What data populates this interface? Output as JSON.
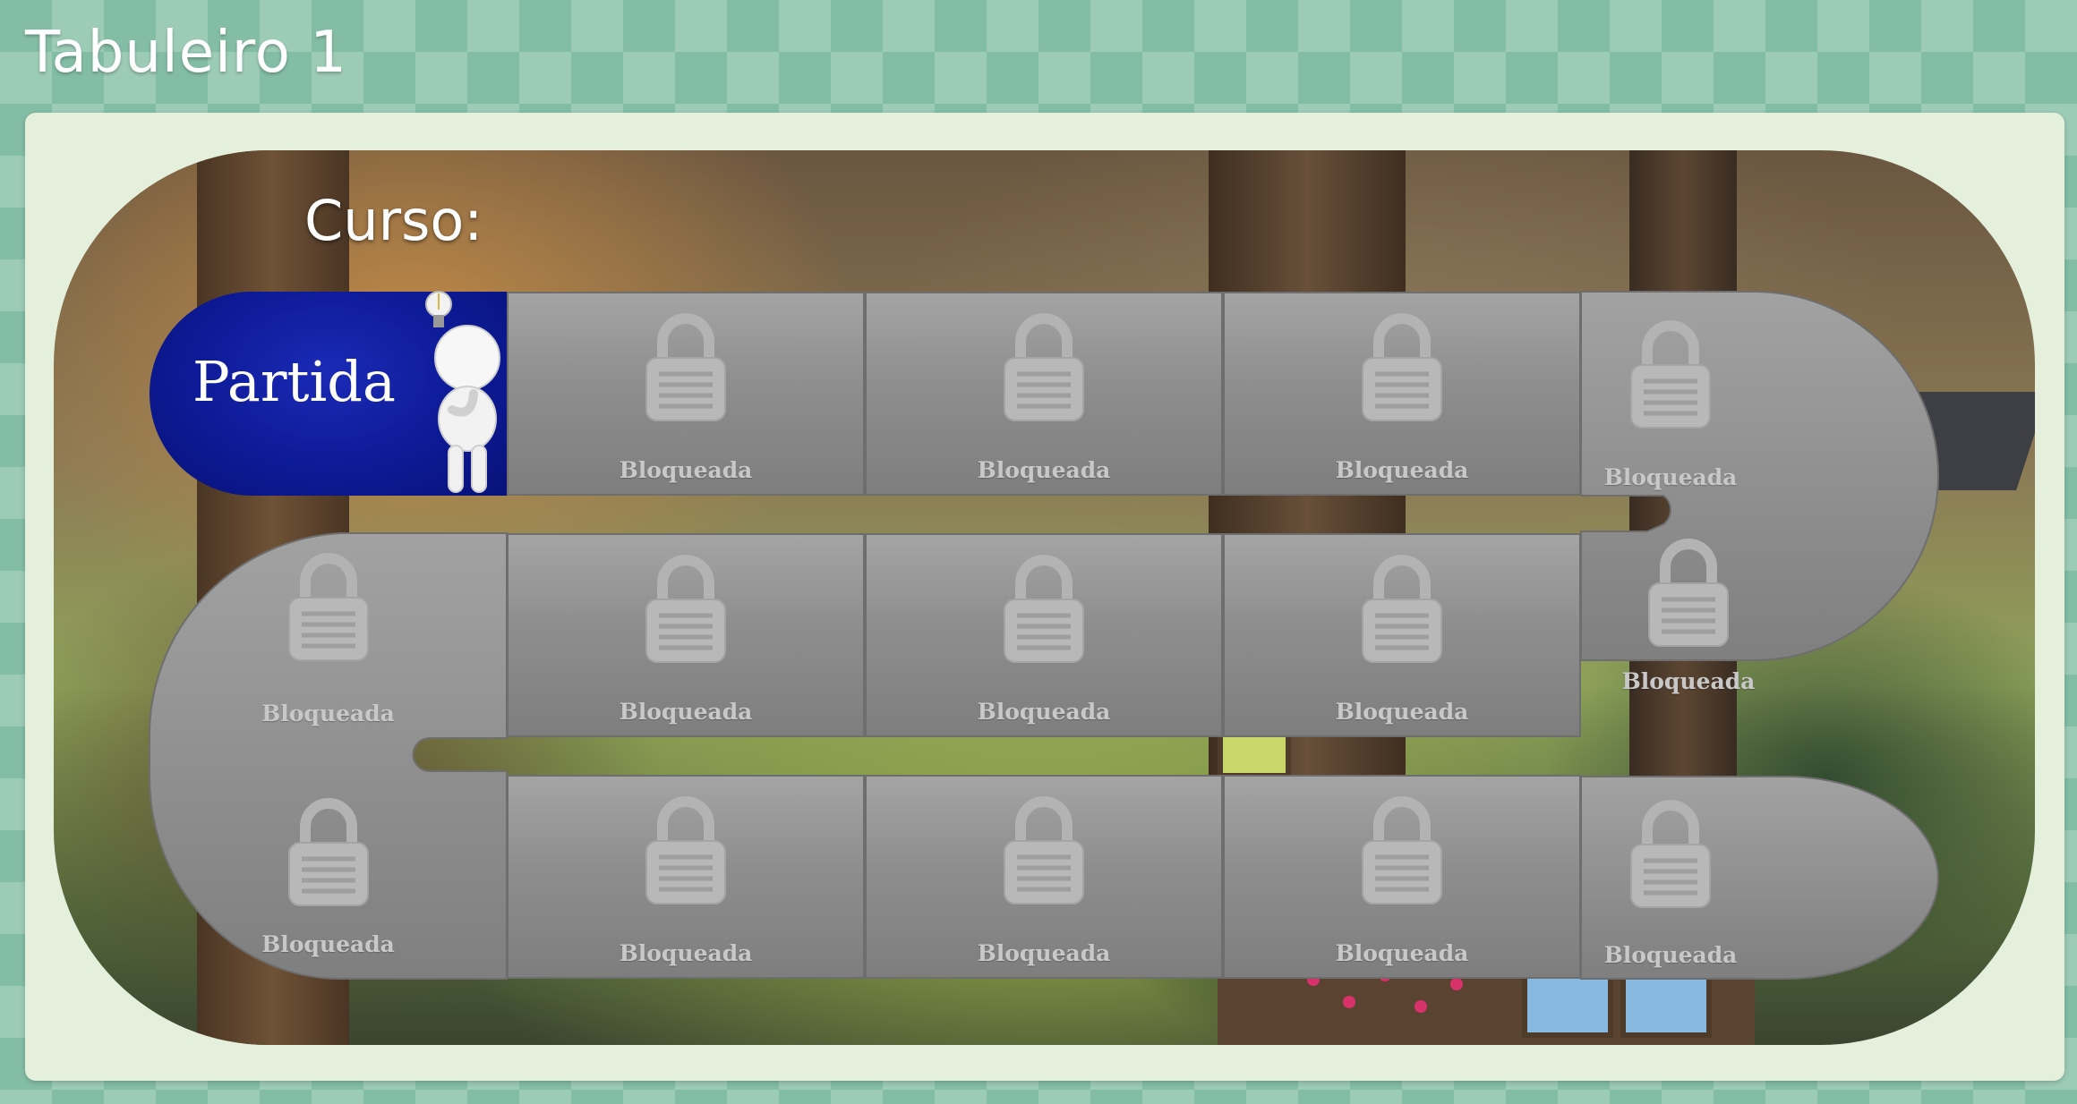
{
  "page": {
    "title": "Tabuleiro 1"
  },
  "board": {
    "course_label": "Curso:",
    "start": {
      "label": "Partida",
      "state": "current"
    },
    "tiles": [
      {
        "label": "Bloqueada",
        "state": "locked",
        "icon": "padlock-icon"
      },
      {
        "label": "Bloqueada",
        "state": "locked",
        "icon": "padlock-icon"
      },
      {
        "label": "Bloqueada",
        "state": "locked",
        "icon": "padlock-icon"
      },
      {
        "label": "Bloqueada",
        "state": "locked",
        "icon": "padlock-icon"
      },
      {
        "label": "Bloqueada",
        "state": "locked",
        "icon": "padlock-icon"
      },
      {
        "label": "Bloqueada",
        "state": "locked",
        "icon": "padlock-icon"
      },
      {
        "label": "Bloqueada",
        "state": "locked",
        "icon": "padlock-icon"
      },
      {
        "label": "Bloqueada",
        "state": "locked",
        "icon": "padlock-icon"
      },
      {
        "label": "Bloqueada",
        "state": "locked",
        "icon": "padlock-icon"
      },
      {
        "label": "Bloqueada",
        "state": "locked",
        "icon": "padlock-icon"
      },
      {
        "label": "Bloqueada",
        "state": "locked",
        "icon": "padlock-icon"
      },
      {
        "label": "Bloqueada",
        "state": "locked",
        "icon": "padlock-icon"
      },
      {
        "label": "Bloqueada",
        "state": "locked",
        "icon": "padlock-icon"
      },
      {
        "label": "Bloqueada",
        "state": "locked",
        "icon": "padlock-icon"
      }
    ]
  },
  "colors": {
    "background": "#84bda6",
    "card": "#e4f0dc",
    "start_tile": "#0d1a96",
    "locked_tile": "#8e8e8e",
    "locked_text": "#c8c8c8"
  }
}
